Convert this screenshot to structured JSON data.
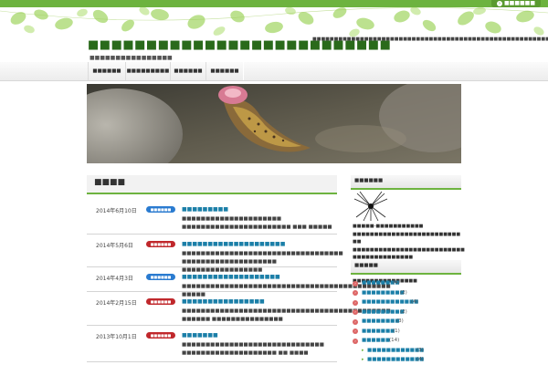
{
  "header": {
    "rss_label": "■■■■■■",
    "site_title": "■■■■■■■■■■■■■■■■■■■■■■■■■■",
    "site_description": "■■■■■■■■■■■■■■■■■■■■■■■■■■■■■■■■■■■■■■■■■■■■■■■■■■■■■■■",
    "site_subtitle": "■■■■■■■■■■■■■■■■"
  },
  "nav": {
    "items": [
      "■■■■■■",
      "■■■■■■■■■",
      "■■■■■■",
      "■■■■■■"
    ]
  },
  "main": {
    "heading": "■■■■",
    "posts": [
      {
        "date": "2014年6月10日",
        "category": "■■■■■■",
        "category_color": "#2a7bd0",
        "title": "■■■■■■■■■",
        "excerpt": "■■■■■■■■■■■■■■■■■■■■■ ■■■■■■■■■■■■■■■■■■■■■■■   ■■■ ■■■■■"
      },
      {
        "date": "2014年5月6日",
        "category": "■■■■■■",
        "category_color": "#c0282c",
        "title": "■■■■■■■■■■■■■■■■■■■■",
        "excerpt": "■■■■■■■■■■■■■■■■■■■■■■■■■■■■■■■■■■ ■■■■■■■■■■■■■■■■■■■■ ■■■■■■■■■■■■■■■■■"
      },
      {
        "date": "2014年4月3日",
        "category": "■■■■■■",
        "category_color": "#2a7bd0",
        "title": "■■■■■■■■■■■■■■■■■■■",
        "excerpt": "■■■■■■■■■■■■■■■■■■■■■■■■■■■■■■■■■■■■■■■■■■■■    ■■■■■"
      },
      {
        "date": "2014年2月15日",
        "category": "■■■■■■",
        "category_color": "#c0282c",
        "title": "■■■■■■■■■■■■■■■■",
        "excerpt": "■■■■■■■■■■■■■■■■■■■■■■■■■■■■■■■■■■■■■■■■■■■■ ■■■■■■ ■■■■■■■■■■■■■■■"
      },
      {
        "date": "2013年10月1日",
        "category": "■■■■■■",
        "category_color": "#c0282c",
        "title": "■■■■■■■",
        "excerpt": "■■■■■■■■■■■■■■■■■■■■■■■■■■■■■■   ■■■■■■■■■■■■■■■■■■■■ ■■ ■■■■"
      }
    ]
  },
  "sidebar": {
    "profile_heading": "■■■■■■",
    "profile_text": "■■■■■-■■■■■■■■■■■ ■■■■■■■■■■■■■■■■■■■■■■■■■ ■■ ■■■■■■■■■■■■■■■■■■■■■■■■■■ ■■■■■■■■■■■■■■",
    "profile_link": "≫■■■■■",
    "profile_footer": "■■■■■■■■■■■■■ ■■■■■■■■■■■■■■■",
    "categories_heading": "■■■■■",
    "categories": [
      {
        "name": "■■■■■■■■",
        "count": "(4)",
        "sub": false
      },
      {
        "name": "■■■■■■■■■",
        "count": "(2)",
        "sub": false
      },
      {
        "name": "■■■■■■■■■■■■",
        "count": "(4)",
        "sub": false
      },
      {
        "name": "■■■■■■■■■",
        "count": "(2)",
        "sub": false
      },
      {
        "name": "■■■■■■■■",
        "count": "(3)",
        "sub": false
      },
      {
        "name": "■■■■■■■",
        "count": "(1)",
        "sub": false
      },
      {
        "name": "■■■■■■",
        "count": "(14)",
        "sub": false
      },
      {
        "name": "■■■■■■■■■■■■",
        "count": "(3)",
        "sub": true
      },
      {
        "name": "■■■■■■■■■■■■",
        "count": "(4)",
        "sub": true
      }
    ]
  },
  "colors": {
    "accent_green": "#6db33f",
    "link_blue": "#1b7fa8",
    "title_green": "#2a6a1b"
  }
}
